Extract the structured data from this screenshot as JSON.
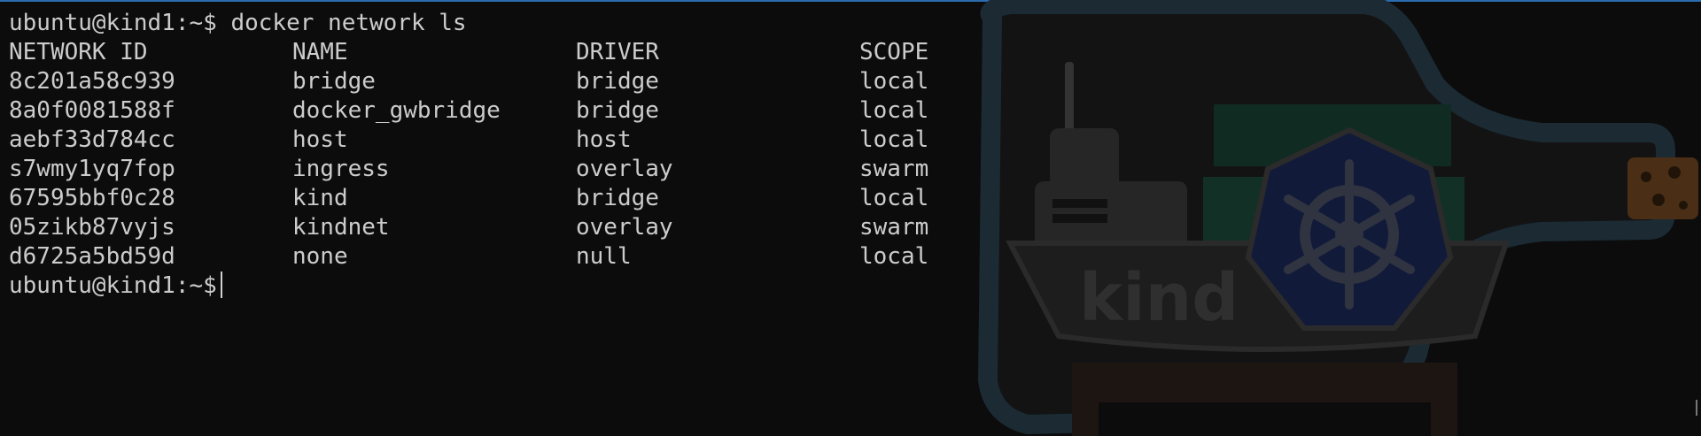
{
  "terminal": {
    "prompt": "ubuntu@kind1:~$",
    "command": "docker network ls",
    "headers": [
      "NETWORK ID",
      "NAME",
      "DRIVER",
      "SCOPE"
    ],
    "rows": [
      [
        "8c201a58c939",
        "bridge",
        "bridge",
        "local"
      ],
      [
        "8a0f0081588f",
        "docker_gwbridge",
        "bridge",
        "local"
      ],
      [
        "aebf33d784cc",
        "host",
        "host",
        "local"
      ],
      [
        "s7wmy1yq7fop",
        "ingress",
        "overlay",
        "swarm"
      ],
      [
        "67595bbf0c28",
        "kind",
        "bridge",
        "local"
      ],
      [
        "05zikb87vyjs",
        "kindnet",
        "overlay",
        "swarm"
      ],
      [
        "d6725a5bd59d",
        "none",
        "null",
        "local"
      ]
    ]
  },
  "background": {
    "logo_text": "kind",
    "icons": [
      "kind-bottle-icon",
      "kubernetes-helm-icon"
    ]
  },
  "colors": {
    "background": "#0c0c0c",
    "text": "#cccccc",
    "window_border": "#2b6cb0"
  }
}
